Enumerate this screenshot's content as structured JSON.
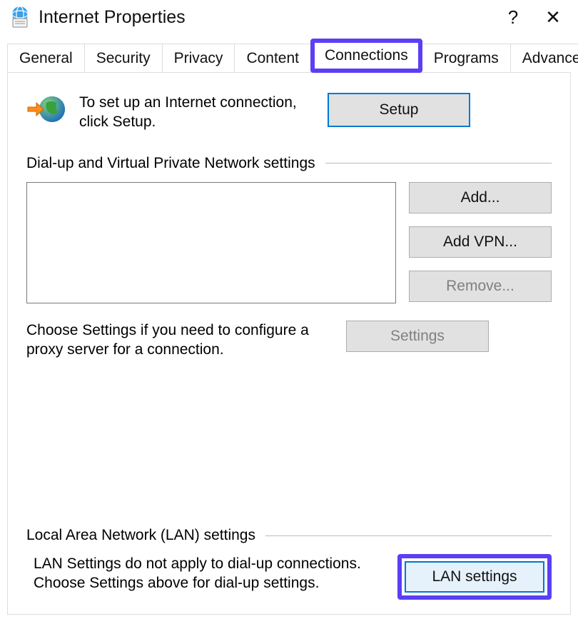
{
  "window": {
    "title": "Internet Properties",
    "help_symbol": "?",
    "close_symbol": "✕"
  },
  "tabs": {
    "general": "General",
    "security": "Security",
    "privacy": "Privacy",
    "content": "Content",
    "connections": "Connections",
    "programs": "Programs",
    "advanced": "Advanced",
    "active": "connections"
  },
  "connections_panel": {
    "setup_text": "To set up an Internet connection, click Setup.",
    "setup_button": "Setup",
    "dialup_heading": "Dial-up and Virtual Private Network settings",
    "add_button": "Add...",
    "add_vpn_button": "Add VPN...",
    "remove_button": "Remove...",
    "settings_button": "Settings",
    "proxy_hint": "Choose Settings if you need to configure a proxy server for a connection.",
    "lan_heading": "Local Area Network (LAN) settings",
    "lan_hint": "LAN Settings do not apply to dial-up connections. Choose Settings above for dial-up settings.",
    "lan_button": "LAN settings"
  },
  "icons": {
    "app": "internet-options-icon",
    "setup": "globe-arrow-icon"
  }
}
